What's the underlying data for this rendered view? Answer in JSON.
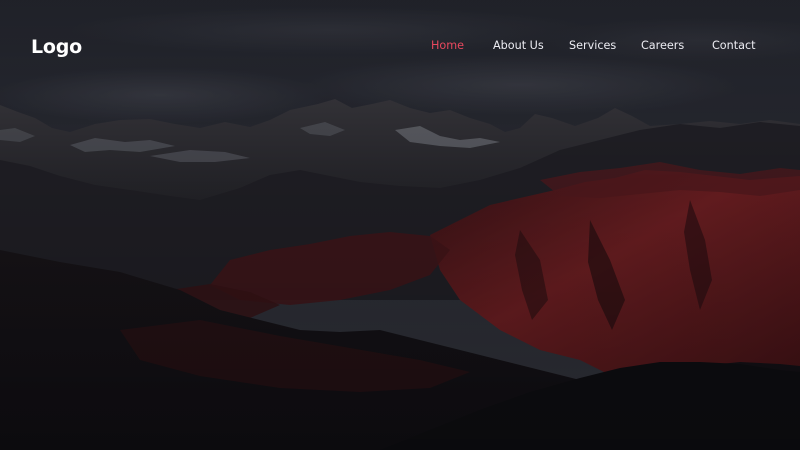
{
  "header": {
    "logo": "Logo",
    "nav": [
      {
        "label": "Home",
        "active": true
      },
      {
        "label": "About Us",
        "active": false
      },
      {
        "label": "Services",
        "active": false
      },
      {
        "label": "Careers",
        "active": false
      },
      {
        "label": "Contact",
        "active": false
      }
    ]
  },
  "colors": {
    "accent": "#e8485e",
    "nav_text": "#ececf2",
    "logo_text": "#ffffff",
    "sky": "#2c2e38",
    "mountain_dark": "#141419",
    "mountain_red": "#6e1e24"
  },
  "background": {
    "subject": "dark mountain range at dusk with red-lit slopes and overcast sky"
  }
}
